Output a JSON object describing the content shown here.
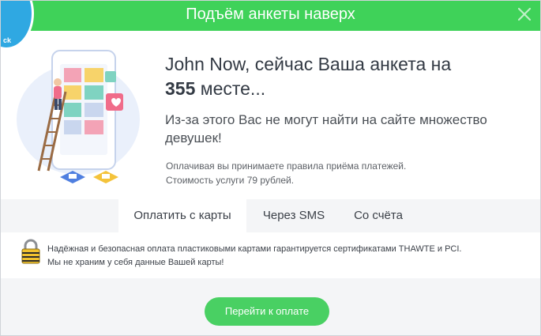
{
  "header": {
    "title": "Подъём анкеты наверх",
    "close_icon": "close-icon",
    "badge_text": "ck"
  },
  "main": {
    "headline_prefix": "John Now, сейчас Ваша анкета на",
    "position": "355",
    "headline_suffix": "месте...",
    "subtitle": "Из-за этого Вас не могут найти на сайте множество девушек!",
    "note_line1": "Оплачивая вы принимаете правила приёма платежей.",
    "note_line2": "Стоимость услуги 79 рублей."
  },
  "tabs": [
    {
      "label": "Оплатить с карты",
      "active": true
    },
    {
      "label": "Через SMS",
      "active": false
    },
    {
      "label": "Со счёта",
      "active": false
    }
  ],
  "security": {
    "icon": "lock-icon",
    "line1": "Надёжная и безопасная оплата пластиковыми картами гарантируется сертификатами THAWTE и PCI.",
    "line2": "Мы не храним у себя данные Вашей карты!"
  },
  "footer": {
    "pay_button": "Перейти к оплате"
  },
  "colors": {
    "header_green": "#3fd259",
    "button_green": "#49d063",
    "badge_blue": "#2fa8e2",
    "tab_bar": "#f4f5f7"
  }
}
